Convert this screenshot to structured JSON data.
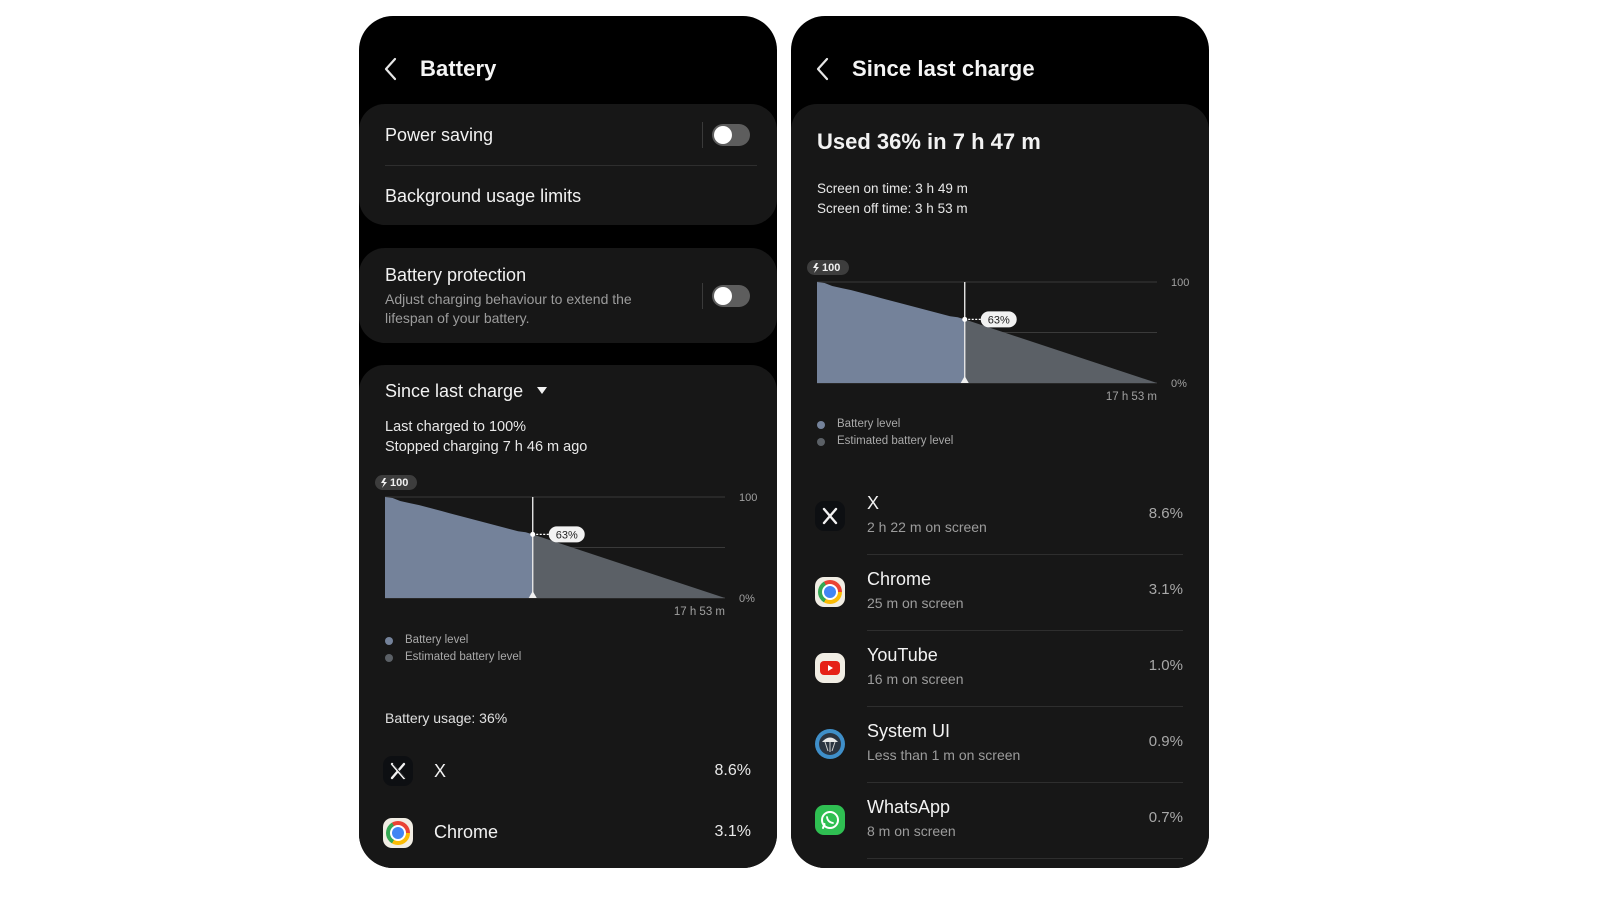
{
  "left_screen": {
    "title": "Battery",
    "power_saving": {
      "label": "Power saving",
      "enabled": false
    },
    "background_limits": {
      "label": "Background usage limits"
    },
    "battery_protection": {
      "label": "Battery protection",
      "description_line1": "Adjust charging behaviour to extend the",
      "description_line2": "lifespan of your battery.",
      "enabled": false
    },
    "period_selector": {
      "label": "Since last charge"
    },
    "last_charged": "Last charged to 100%",
    "stopped_charging": "Stopped charging 7 h 46 m ago",
    "legend": [
      "Battery level",
      "Estimated battery level"
    ],
    "usage_total": "Battery usage: 36%",
    "apps": [
      {
        "name": "X",
        "percent": "8.6%",
        "icon": "x-logo-icon"
      },
      {
        "name": "Chrome",
        "percent": "3.1%",
        "icon": "chrome-icon"
      }
    ]
  },
  "right_screen": {
    "title": "Since last charge",
    "headline": "Used 36% in 7 h 47 m",
    "screen_on": "Screen on time: 3 h 49 m",
    "screen_off": "Screen off time: 3 h 53 m",
    "legend": [
      "Battery level",
      "Estimated battery level"
    ],
    "apps": [
      {
        "name": "X",
        "sub": "2 h 22 m on screen",
        "percent": "8.6%",
        "icon": "x-logo-icon"
      },
      {
        "name": "Chrome",
        "sub": "25 m on screen",
        "percent": "3.1%",
        "icon": "chrome-icon"
      },
      {
        "name": "YouTube",
        "sub": "16 m on screen",
        "percent": "1.0%",
        "icon": "youtube-icon"
      },
      {
        "name": "System UI",
        "sub": "Less than 1 m on screen",
        "percent": "0.9%",
        "icon": "system-ui-icon"
      },
      {
        "name": "WhatsApp",
        "sub": "8 m on screen",
        "percent": "0.7%",
        "icon": "whatsapp-icon"
      }
    ]
  },
  "colors": {
    "battery_level": "#74829a",
    "estimated_level": "#5b6066",
    "card_bg": "#171717"
  },
  "chart_data": {
    "type": "area",
    "title": "",
    "charge_badge": "100",
    "y_ticks": [
      "100",
      "0%"
    ],
    "x_end_label": "17 h 53 m",
    "ylim": [
      0,
      100
    ],
    "xlim_hours": [
      0,
      17.883
    ],
    "current_marker": {
      "hours": 7.77,
      "value": 63,
      "label": "63%"
    },
    "gridlines": [
      100,
      50,
      0
    ],
    "series": [
      {
        "name": "Battery level",
        "points": [
          [
            0,
            100
          ],
          [
            0.4,
            99
          ],
          [
            0.8,
            96
          ],
          [
            1.3,
            94
          ],
          [
            1.8,
            92
          ],
          [
            2.2,
            90
          ],
          [
            2.6,
            88
          ],
          [
            3.0,
            86
          ],
          [
            3.4,
            84
          ],
          [
            3.8,
            82
          ],
          [
            4.2,
            80
          ],
          [
            4.6,
            78
          ],
          [
            5.0,
            76
          ],
          [
            5.4,
            74
          ],
          [
            5.8,
            72
          ],
          [
            6.2,
            70
          ],
          [
            6.6,
            68
          ],
          [
            7.0,
            66
          ],
          [
            7.4,
            65
          ],
          [
            7.77,
            63
          ]
        ]
      },
      {
        "name": "Estimated battery level",
        "points": [
          [
            7.77,
            63
          ],
          [
            17.883,
            0
          ]
        ]
      }
    ]
  }
}
